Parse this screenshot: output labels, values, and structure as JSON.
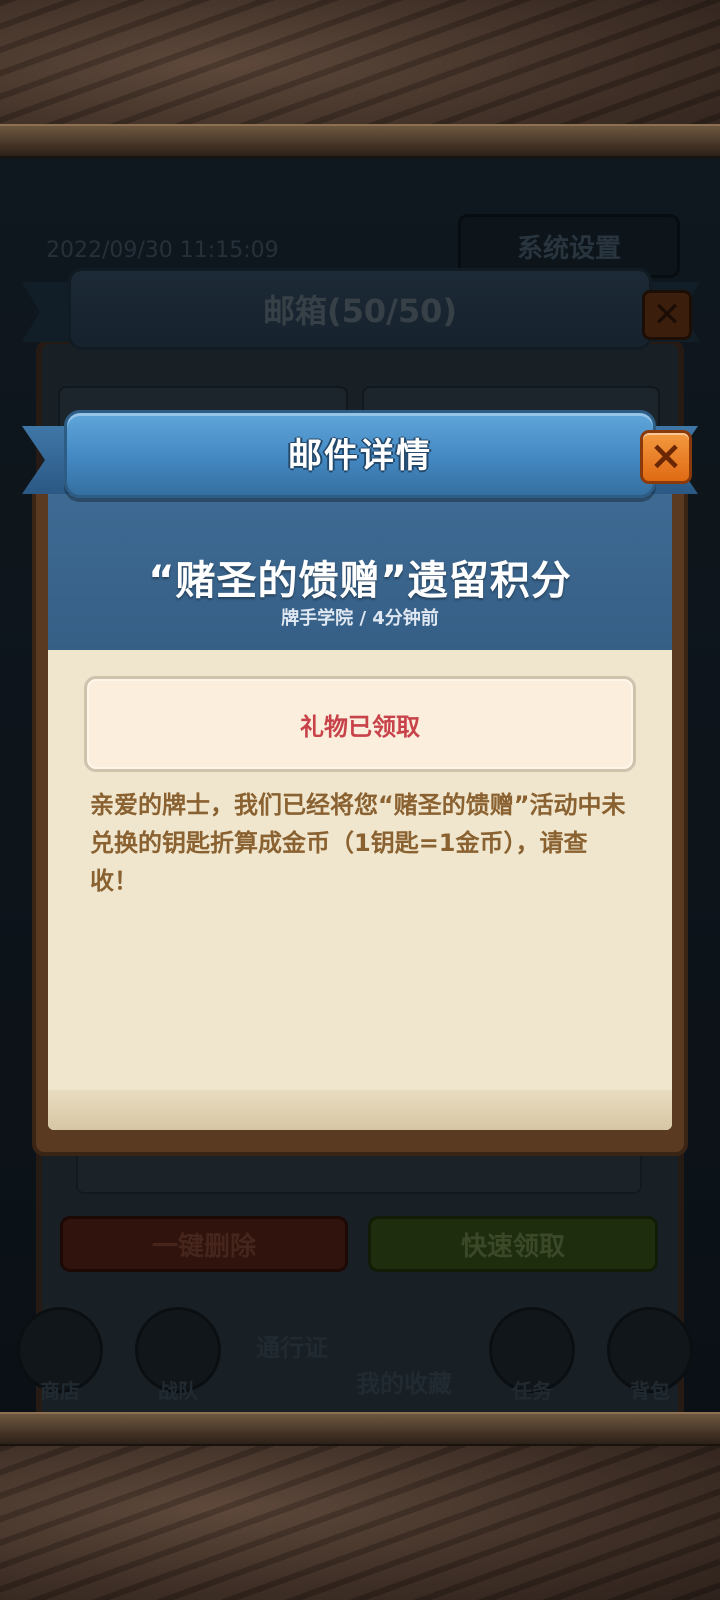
{
  "background": {
    "timestamp": "2022/09/30 11:15:09",
    "settings_button": "系统设置"
  },
  "mailbox": {
    "title": "邮箱(50/50)",
    "close_icon": "close-icon",
    "actions": {
      "delete_all": "一键删除",
      "quick_claim": "快速领取"
    }
  },
  "bottom_nav": {
    "items": [
      {
        "label": "商店",
        "icon": "shop-icon"
      },
      {
        "label": "战队",
        "icon": "team-icon"
      },
      {
        "label": "通行证",
        "icon": "pass-icon"
      },
      {
        "label": "我的收藏",
        "icon": "collection-icon"
      },
      {
        "label": "任务",
        "icon": "task-icon"
      },
      {
        "label": "背包",
        "icon": "bag-icon"
      }
    ]
  },
  "mail_detail": {
    "header": "邮件详情",
    "close_icon": "close-icon",
    "title": "“赌圣的馈赠”遗留积分",
    "meta": "牌手学院 / 4分钟前",
    "gift_status": "礼物已领取",
    "body": "亲爱的牌士，我们已经将您“赌圣的馈赠”活动中未兑换的钥匙折算成金币（1钥匙=1金币），请查收！"
  },
  "colors": {
    "ribbon_blue": "#4488c2",
    "header_blue": "#3e6a93",
    "close_orange": "#e06a14",
    "gift_red": "#c8424a",
    "body_brown": "#8a6130"
  }
}
